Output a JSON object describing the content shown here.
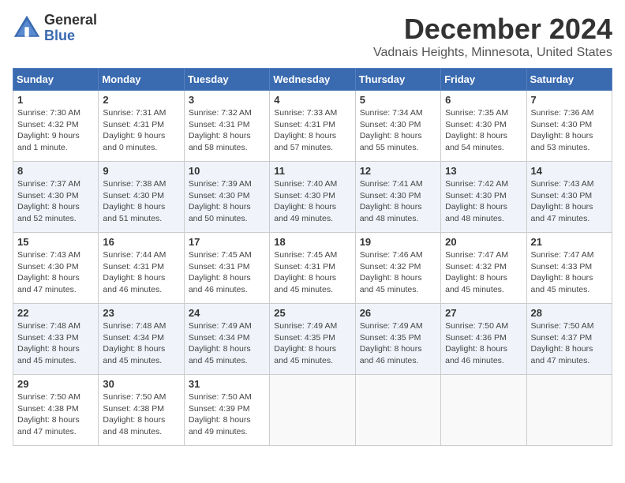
{
  "header": {
    "logo_line1": "General",
    "logo_line2": "Blue",
    "main_title": "December 2024",
    "subtitle": "Vadnais Heights, Minnesota, United States"
  },
  "calendar": {
    "days_of_week": [
      "Sunday",
      "Monday",
      "Tuesday",
      "Wednesday",
      "Thursday",
      "Friday",
      "Saturday"
    ],
    "weeks": [
      [
        {
          "day": 1,
          "info": "Sunrise: 7:30 AM\nSunset: 4:32 PM\nDaylight: 9 hours\nand 1 minute."
        },
        {
          "day": 2,
          "info": "Sunrise: 7:31 AM\nSunset: 4:31 PM\nDaylight: 9 hours\nand 0 minutes."
        },
        {
          "day": 3,
          "info": "Sunrise: 7:32 AM\nSunset: 4:31 PM\nDaylight: 8 hours\nand 58 minutes."
        },
        {
          "day": 4,
          "info": "Sunrise: 7:33 AM\nSunset: 4:31 PM\nDaylight: 8 hours\nand 57 minutes."
        },
        {
          "day": 5,
          "info": "Sunrise: 7:34 AM\nSunset: 4:30 PM\nDaylight: 8 hours\nand 55 minutes."
        },
        {
          "day": 6,
          "info": "Sunrise: 7:35 AM\nSunset: 4:30 PM\nDaylight: 8 hours\nand 54 minutes."
        },
        {
          "day": 7,
          "info": "Sunrise: 7:36 AM\nSunset: 4:30 PM\nDaylight: 8 hours\nand 53 minutes."
        }
      ],
      [
        {
          "day": 8,
          "info": "Sunrise: 7:37 AM\nSunset: 4:30 PM\nDaylight: 8 hours\nand 52 minutes."
        },
        {
          "day": 9,
          "info": "Sunrise: 7:38 AM\nSunset: 4:30 PM\nDaylight: 8 hours\nand 51 minutes."
        },
        {
          "day": 10,
          "info": "Sunrise: 7:39 AM\nSunset: 4:30 PM\nDaylight: 8 hours\nand 50 minutes."
        },
        {
          "day": 11,
          "info": "Sunrise: 7:40 AM\nSunset: 4:30 PM\nDaylight: 8 hours\nand 49 minutes."
        },
        {
          "day": 12,
          "info": "Sunrise: 7:41 AM\nSunset: 4:30 PM\nDaylight: 8 hours\nand 48 minutes."
        },
        {
          "day": 13,
          "info": "Sunrise: 7:42 AM\nSunset: 4:30 PM\nDaylight: 8 hours\nand 48 minutes."
        },
        {
          "day": 14,
          "info": "Sunrise: 7:43 AM\nSunset: 4:30 PM\nDaylight: 8 hours\nand 47 minutes."
        }
      ],
      [
        {
          "day": 15,
          "info": "Sunrise: 7:43 AM\nSunset: 4:30 PM\nDaylight: 8 hours\nand 47 minutes."
        },
        {
          "day": 16,
          "info": "Sunrise: 7:44 AM\nSunset: 4:31 PM\nDaylight: 8 hours\nand 46 minutes."
        },
        {
          "day": 17,
          "info": "Sunrise: 7:45 AM\nSunset: 4:31 PM\nDaylight: 8 hours\nand 46 minutes."
        },
        {
          "day": 18,
          "info": "Sunrise: 7:45 AM\nSunset: 4:31 PM\nDaylight: 8 hours\nand 45 minutes."
        },
        {
          "day": 19,
          "info": "Sunrise: 7:46 AM\nSunset: 4:32 PM\nDaylight: 8 hours\nand 45 minutes."
        },
        {
          "day": 20,
          "info": "Sunrise: 7:47 AM\nSunset: 4:32 PM\nDaylight: 8 hours\nand 45 minutes."
        },
        {
          "day": 21,
          "info": "Sunrise: 7:47 AM\nSunset: 4:33 PM\nDaylight: 8 hours\nand 45 minutes."
        }
      ],
      [
        {
          "day": 22,
          "info": "Sunrise: 7:48 AM\nSunset: 4:33 PM\nDaylight: 8 hours\nand 45 minutes."
        },
        {
          "day": 23,
          "info": "Sunrise: 7:48 AM\nSunset: 4:34 PM\nDaylight: 8 hours\nand 45 minutes."
        },
        {
          "day": 24,
          "info": "Sunrise: 7:49 AM\nSunset: 4:34 PM\nDaylight: 8 hours\nand 45 minutes."
        },
        {
          "day": 25,
          "info": "Sunrise: 7:49 AM\nSunset: 4:35 PM\nDaylight: 8 hours\nand 45 minutes."
        },
        {
          "day": 26,
          "info": "Sunrise: 7:49 AM\nSunset: 4:35 PM\nDaylight: 8 hours\nand 46 minutes."
        },
        {
          "day": 27,
          "info": "Sunrise: 7:50 AM\nSunset: 4:36 PM\nDaylight: 8 hours\nand 46 minutes."
        },
        {
          "day": 28,
          "info": "Sunrise: 7:50 AM\nSunset: 4:37 PM\nDaylight: 8 hours\nand 47 minutes."
        }
      ],
      [
        {
          "day": 29,
          "info": "Sunrise: 7:50 AM\nSunset: 4:38 PM\nDaylight: 8 hours\nand 47 minutes."
        },
        {
          "day": 30,
          "info": "Sunrise: 7:50 AM\nSunset: 4:38 PM\nDaylight: 8 hours\nand 48 minutes."
        },
        {
          "day": 31,
          "info": "Sunrise: 7:50 AM\nSunset: 4:39 PM\nDaylight: 8 hours\nand 49 minutes."
        },
        null,
        null,
        null,
        null
      ]
    ]
  }
}
